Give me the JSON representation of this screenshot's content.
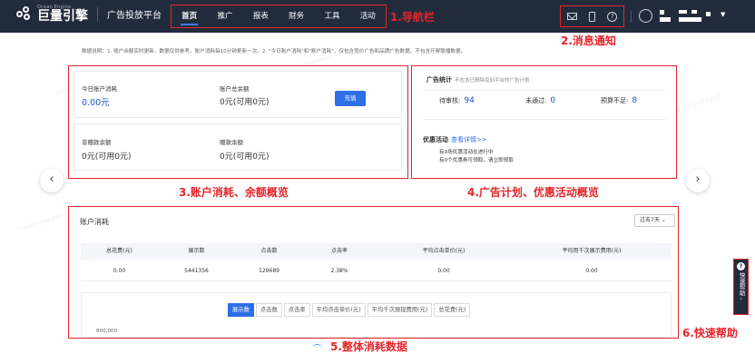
{
  "header": {
    "logo_en": "Ocean Engine",
    "logo_cn": "巨量引擎",
    "platform": "广告投放平台",
    "nav": [
      "首页",
      "推广",
      "报表",
      "财务",
      "工具",
      "活动"
    ],
    "active_nav": "首页"
  },
  "notice": "数据说明：1. 账户余额实时更新，数据仅供参考。账户消耗每10分钟更新一次。2. \"今日账户消耗\"和\"账户消耗\"，仅包含竞价广告和品牌广告数据，不包含开屏联播数据。",
  "account": {
    "today_label": "今日账户消耗",
    "today_value": "0.00元",
    "total_label": "账户总余额",
    "total_value": "0元(可用0元)",
    "charge_button": "充值",
    "nongift_label": "非赠款余额",
    "nongift_value": "0元(可用0元)",
    "gift_label": "赠款余额",
    "gift_value": "0元(可用0元)"
  },
  "ad_stats": {
    "title": "广告统计",
    "subtitle": "不包含已删除及旧平台的广告计划",
    "pending_label": "待审核:",
    "pending_value": "94",
    "rejected_label": "未通过:",
    "rejected_value": "0",
    "budget_label": "预算不足:",
    "budget_value": "8",
    "promo_title": "优惠活动",
    "promo_link": "查看详情>>",
    "promo_line1": "有0场优惠活动在进行中",
    "promo_line2": "有0个优惠券可领取，请立即领取"
  },
  "consumption": {
    "title": "账户消耗",
    "range": "过去7天",
    "columns": [
      "总花费(元)",
      "展示数",
      "点击数",
      "点击率",
      "平均点击单价(元)",
      "平均用千次展示费用(元)"
    ],
    "row": [
      "0.00",
      "5441356",
      "129689",
      "2.38%",
      "0.00",
      "0.00"
    ],
    "metric_tabs": [
      "展示数",
      "点击数",
      "点击率",
      "平均点击单价(元)",
      "平均千次展现费用(元)",
      "总花费(元)"
    ],
    "active_metric": "展示数",
    "y_tick": "800,000"
  },
  "callouts": {
    "c1": "1.导航栏",
    "c2": "2.消息通知",
    "c3": "3.账户消耗、余额概览",
    "c4": "4.广告计划、优惠活动概览",
    "c5": "5.整体消耗数据",
    "c6": "6.快速帮助"
  },
  "help": {
    "label": "快速帮助"
  },
  "watermark": "caopeiyue.carol",
  "colors": {
    "topbar": "#222b3c",
    "accent": "#2e6ee6",
    "annotation": "#e5252a",
    "value_blue": "#1f56d0"
  }
}
